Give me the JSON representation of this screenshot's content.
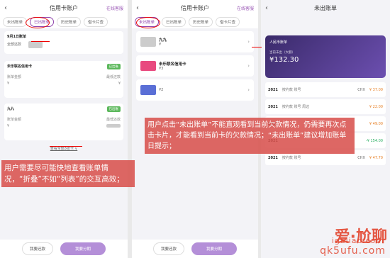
{
  "panel1": {
    "title": "信用卡账户",
    "service": "在线客服",
    "tabs": [
      "未出账单",
      "已出账单",
      "历史账单",
      "借卡片查"
    ],
    "bill_date": "9月1日账单",
    "bill_sub": "全部还款",
    "card1_name": "未乐联名信用卡",
    "card1_tag": "已出账",
    "card1_labels": [
      "账单金额",
      "最低还款"
    ],
    "card1_values": [
      "¥",
      "¥"
    ],
    "card2_name": "九九",
    "card2_tag": "已出账",
    "card2_labels": [
      "账单金额",
      "最低还款"
    ],
    "card2_values": [
      "¥",
      "¥"
    ],
    "expand": "查看全部3张卡 ∨",
    "btn_left": "我要还款",
    "btn_right": "我要分期"
  },
  "panel2": {
    "title": "信用卡账户",
    "service": "在线客服",
    "tabs": [
      "未出账单",
      "已出账单",
      "历史账单",
      "借卡片查"
    ],
    "cards": [
      {
        "name": "九九",
        "sub": "¥",
        "color": "#ddd"
      },
      {
        "name": "未乐联名信用卡",
        "sub": "¥3",
        "color": "#e84a7f"
      },
      {
        "name": "",
        "sub": "¥2",
        "color": "#5a6fd6"
      }
    ],
    "btn_left": "我要还款",
    "btn_right": "我要分期"
  },
  "panel3": {
    "title": "未出账单",
    "card_label": "人民币账单",
    "card_sub": "当前未出（大额）",
    "amount": "¥132.30",
    "tx": [
      {
        "date": "2021",
        "desc": "按约款 账号",
        "ref": "CHX",
        "amt": "¥ 37.00",
        "green": false
      },
      {
        "date": "2021",
        "desc": "按约款 账号 周边",
        "ref": "",
        "amt": "¥ 22.00",
        "green": false
      },
      {
        "date": "2021",
        "desc": "",
        "ref": "",
        "amt": "¥ 49.00",
        "green": false
      },
      {
        "date": "2021",
        "desc": "",
        "ref": "",
        "amt": "-¥ 154.00",
        "green": true
      },
      {
        "date": "2021",
        "desc": "按约款 账号",
        "ref": "CHX",
        "amt": "¥ 47.70",
        "green": false
      }
    ]
  },
  "annotations": {
    "left": "用户需要尽可能快地查看账单情况，“折叠”不如“列表”的交互高效；",
    "right": "用户点击“未出账单”不能直观看到当前欠款情况，仍需要再次点击卡片，才能看到当前卡的欠款情况；“未出账单”建议增加账单日提示；"
  },
  "watermark": {
    "logo": "爱·尬聊",
    "url": "igaliao.com",
    "domain": "qk5ufu.com"
  }
}
